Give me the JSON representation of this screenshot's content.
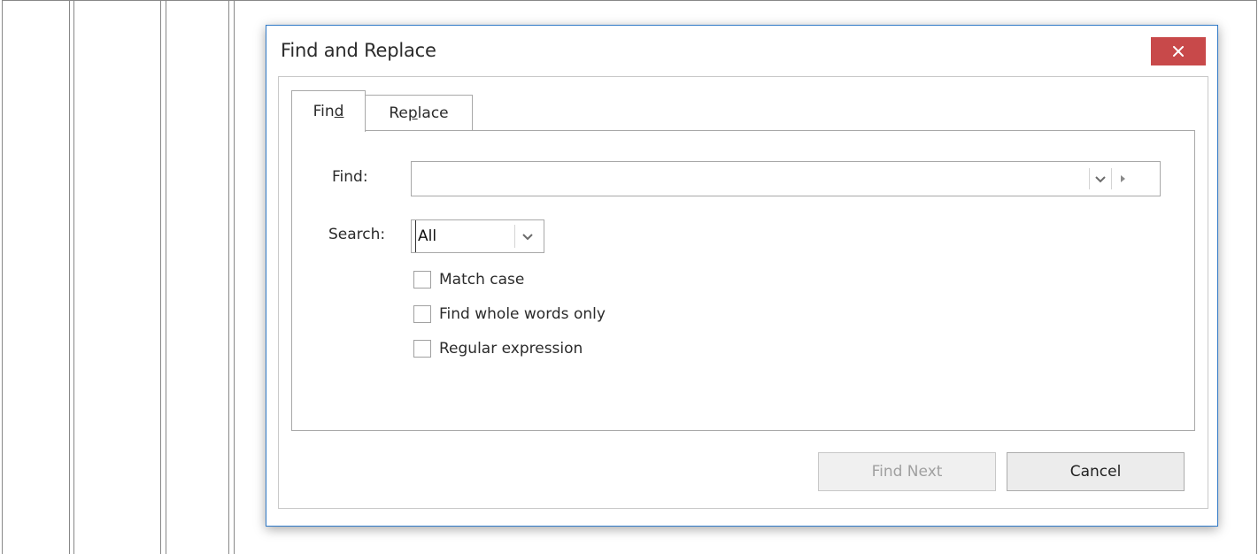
{
  "dialog": {
    "title": "Find and Replace",
    "close_icon": "close-icon",
    "accent_color": "#c8494a",
    "border_color": "#2f79c7"
  },
  "tabs": [
    {
      "pre": "Fin",
      "mnemonic": "d",
      "post": "",
      "active": true
    },
    {
      "pre": "Re",
      "mnemonic": "p",
      "post": "lace",
      "active": false
    }
  ],
  "find": {
    "label": "Find:",
    "value": "",
    "dropdown_icon": "chevron-down-icon",
    "options_icon": "triangle-right-icon"
  },
  "search": {
    "label": "Search:",
    "value": "All",
    "dropdown_icon": "chevron-down-icon"
  },
  "options": [
    {
      "label": "Match case",
      "checked": false
    },
    {
      "label": "Find whole words only",
      "checked": false
    },
    {
      "label": "Regular expression",
      "checked": false
    }
  ],
  "buttons": {
    "find_next": "Find Next",
    "find_next_enabled": false,
    "cancel": "Cancel"
  }
}
